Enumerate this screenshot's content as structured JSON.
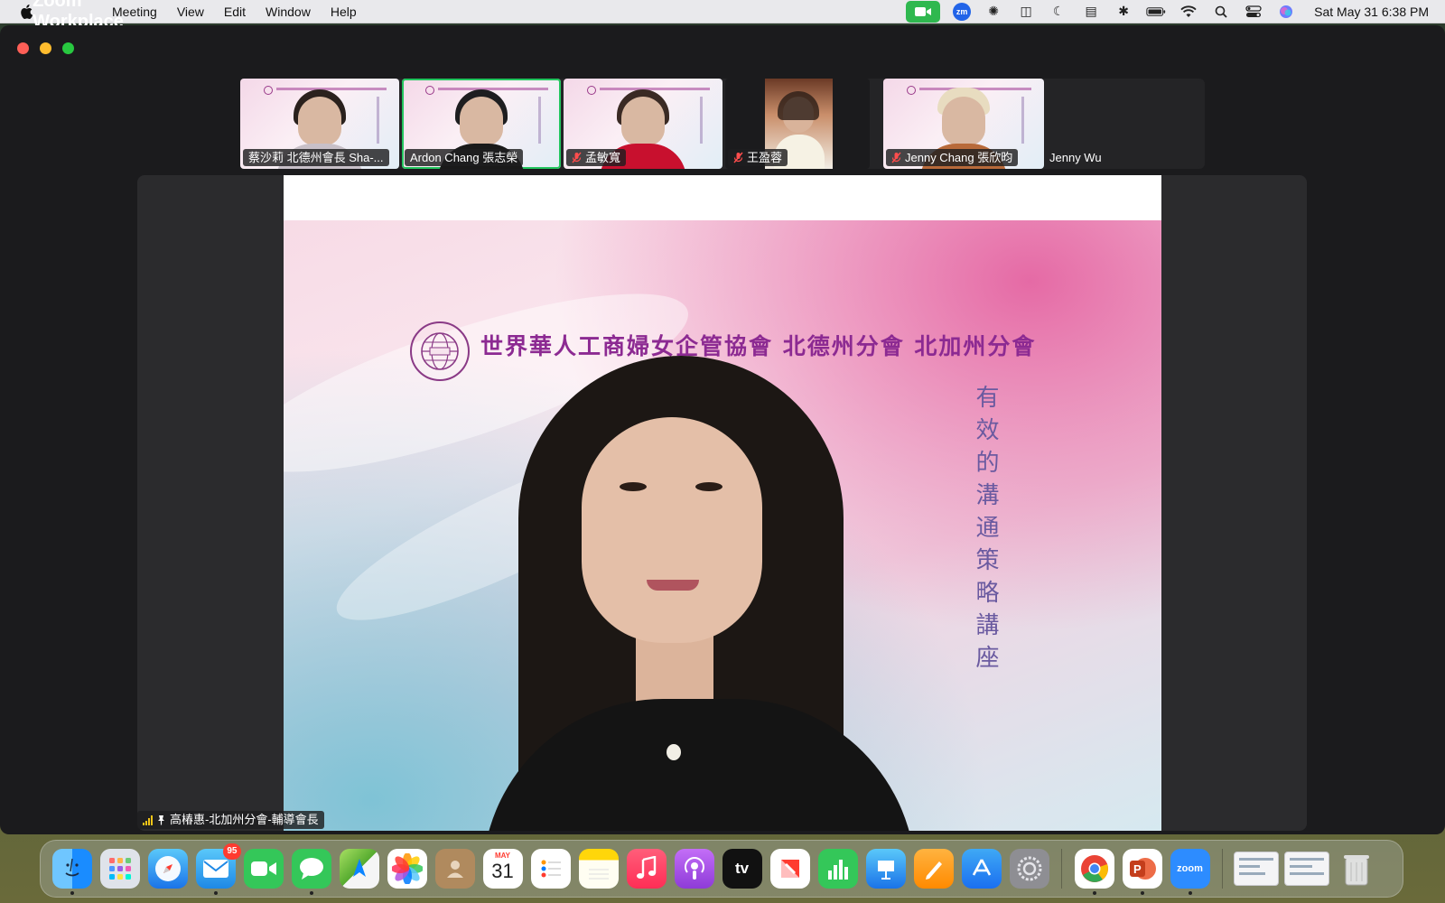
{
  "menubar": {
    "app_name": "Zoom Workplace",
    "menus": [
      "Meeting",
      "View",
      "Edit",
      "Window",
      "Help"
    ],
    "clock": "Sat May 31  6:38 PM",
    "zoom_badge": "zm"
  },
  "participants": [
    {
      "name": "蔡沙莉 北德州會長 Sha-...",
      "muted": false,
      "active": false
    },
    {
      "name": "Ardon Chang 張志榮",
      "muted": false,
      "active": true
    },
    {
      "name": "孟敏寬",
      "muted": true,
      "active": false
    },
    {
      "name": "王盈蓉",
      "muted": true,
      "active": false
    },
    {
      "name": "Jenny Chang 張欣昀",
      "muted": true,
      "active": false
    },
    {
      "name": "Jenny Wu",
      "muted": false,
      "active": false
    }
  ],
  "slide": {
    "org_title": "世界華人工商婦女企管協會 北德州分會 北加州分會",
    "vertical_title": "有效的溝通策略講座"
  },
  "speaker": {
    "name": "高椿惠-北加州分會-輔導會長"
  },
  "dock": {
    "mail_badge": "95",
    "calendar_month": "MAY",
    "calendar_day": "31",
    "tv_label": "tv",
    "zoom_label": "zoom"
  }
}
